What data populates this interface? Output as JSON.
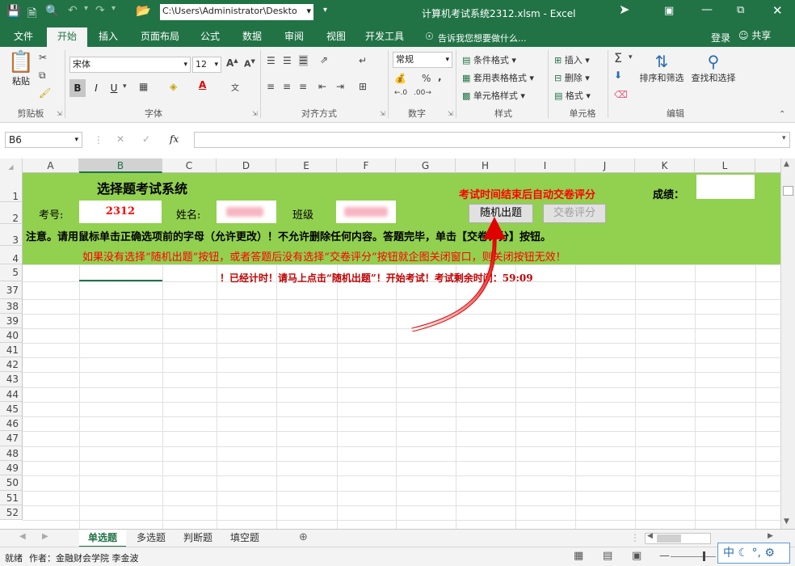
{
  "titlebar": {
    "path": "C:\\Users\\Administrator\\Deskto",
    "title": "计算机考试系统2312.xlsm - Excel"
  },
  "menu": {
    "items": [
      "文件",
      "开始",
      "插入",
      "页面布局",
      "公式",
      "数据",
      "审阅",
      "视图",
      "开发工具"
    ],
    "active": "开始",
    "tell_me": "告诉我您想要做什么...",
    "login": "登录",
    "share": "共享"
  },
  "ribbon": {
    "clipboard": {
      "paste": "粘贴",
      "label": "剪贴板"
    },
    "font": {
      "name": "宋体",
      "size": "12",
      "bold": "B",
      "italic": "I",
      "underline": "U",
      "label": "字体"
    },
    "alignment": {
      "label": "对齐方式"
    },
    "number": {
      "format": "常规",
      "label": "数字",
      "percent": "%"
    },
    "styles": {
      "conditional": "条件格式",
      "table": "套用表格格式",
      "cell": "单元格样式",
      "label": "样式"
    },
    "cells": {
      "insert": "插入",
      "delete": "删除",
      "format": "格式",
      "label": "单元格"
    },
    "editing": {
      "sort": "排序和筛选",
      "find": "查找和选择",
      "label": "编辑"
    }
  },
  "formula_bar": {
    "name_box": "B6",
    "fx": "fx",
    "content": ""
  },
  "columns": [
    "A",
    "B",
    "C",
    "D",
    "E",
    "F",
    "G",
    "H",
    "I",
    "J",
    "K",
    "L"
  ],
  "rows": [
    "1",
    "2",
    "3",
    "4",
    "5",
    "37",
    "38",
    "39",
    "40",
    "41",
    "42",
    "43",
    "44",
    "45",
    "46",
    "47",
    "48",
    "49",
    "50",
    "51",
    "52"
  ],
  "sheet": {
    "title": "选择题考试系统",
    "auto_submit": "考试时间结束后自动交卷评分",
    "score_label": "成绩：",
    "exam_no_label": "考号:",
    "exam_no": "2312",
    "name_label": "姓名:",
    "class_label": "班级",
    "random_button": "随机出题",
    "submit_button": "交卷评分",
    "notice": "注意。请用鼠标单击正确选项前的字母（允许更改）！不允许删除任何内容。答题完毕，单击【交卷评分】按钮。",
    "warning": "如果没有选择“随机出题”按钮，或者答题后没有选择“交卷评分”按钮就企图关闭窗口，则关闭按钮无效！",
    "timer": "！已经计时！请马上点击“随机出题”！开始考试！考试剩余时间：59:09"
  },
  "sheet_tabs": [
    "单选题",
    "多选题",
    "判断题",
    "填空题"
  ],
  "active_sheet": "单选题",
  "status": {
    "ready": "就绪",
    "author": "作者：金融财会学院 李金波",
    "ime": "中"
  },
  "colors": {
    "excel_green": "#217346",
    "band_green": "#92d050",
    "red_text": "#ff0000",
    "dark_red_text": "#c00000"
  }
}
